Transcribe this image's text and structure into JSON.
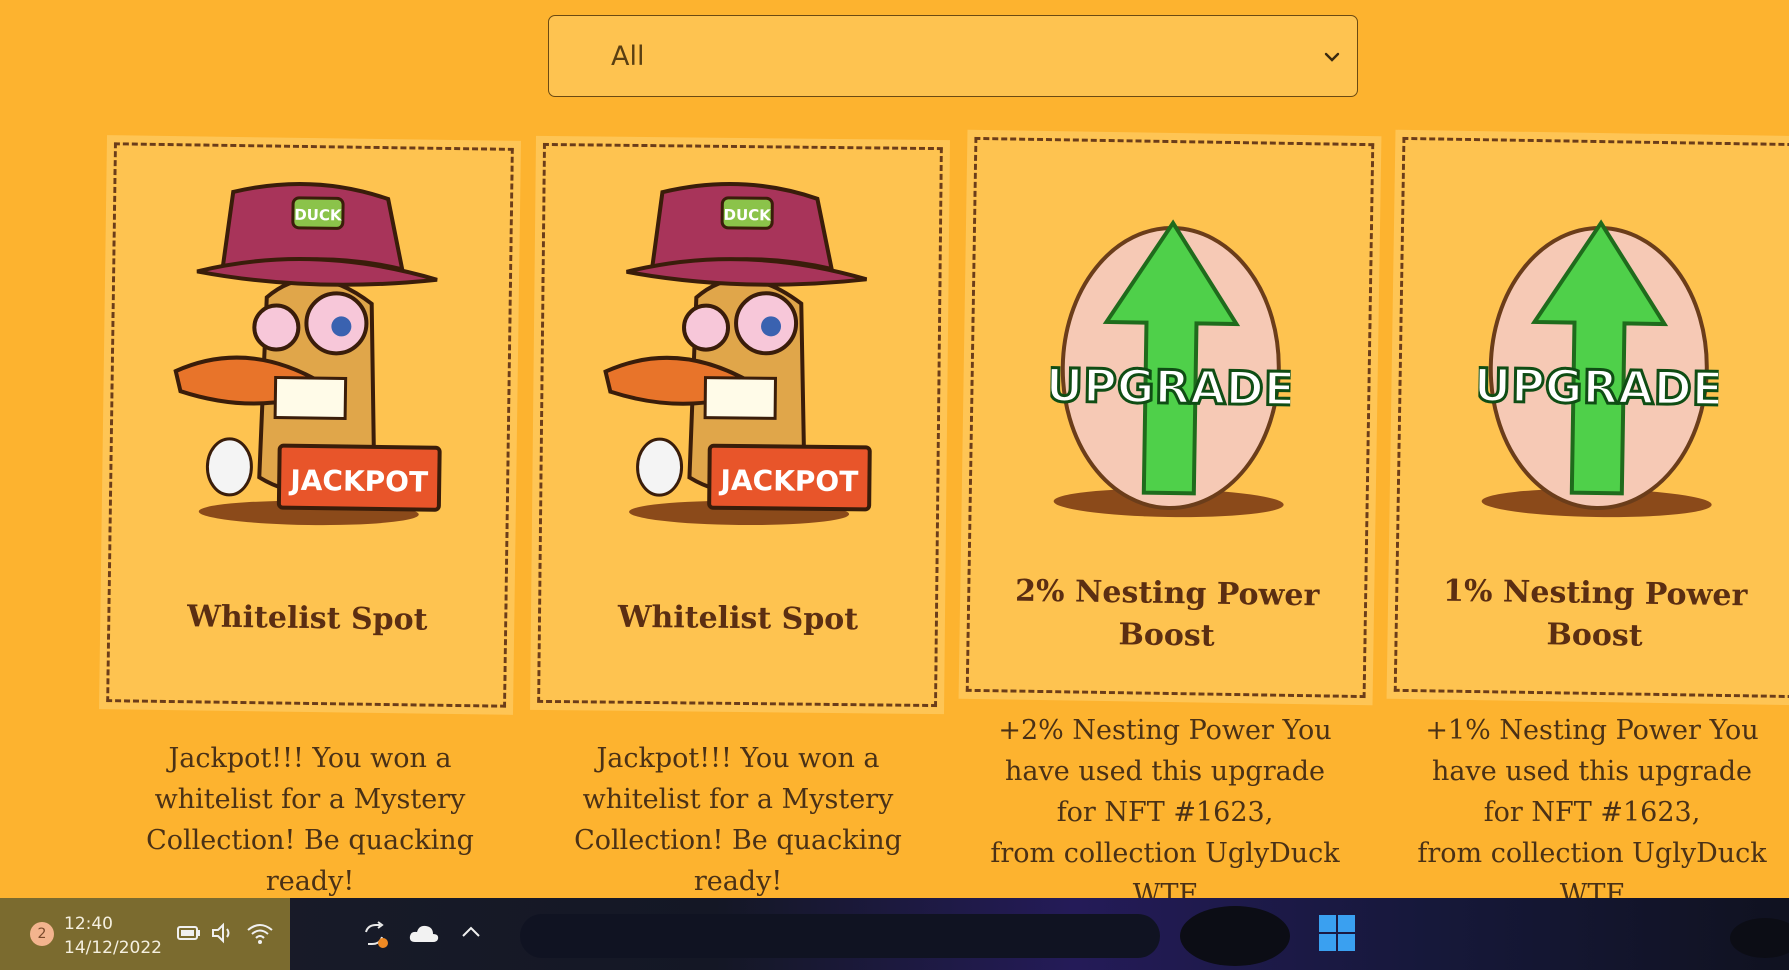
{
  "filter": {
    "selected": "All"
  },
  "cards": [
    {
      "art": "jackpot-duck",
      "art_label": "JACKPOT",
      "hat_label": "DUCK",
      "title": "Whitelist Spot",
      "description_lines": [
        "Jackpot!!! You won a",
        "whitelist for a Mystery",
        "Collection! Be quacking",
        "ready!"
      ]
    },
    {
      "art": "jackpot-duck",
      "art_label": "JACKPOT",
      "hat_label": "DUCK",
      "title": "Whitelist Spot",
      "description_lines": [
        "Jackpot!!! You won a",
        "whitelist for a Mystery",
        "Collection! Be quacking",
        "ready!"
      ]
    },
    {
      "art": "upgrade-egg",
      "art_label": "UPGRADE",
      "title_lines": [
        "2% Nesting Power",
        "Boost"
      ],
      "description_lines": [
        "+2% Nesting Power You",
        "have used this upgrade",
        "for NFT #1623,",
        "from collection UglyDuck",
        "WTF"
      ]
    },
    {
      "art": "upgrade-egg",
      "art_label": "UPGRADE",
      "title_lines": [
        "1% Nesting Power",
        "Boost"
      ],
      "description_lines": [
        "+1% Nesting Power You",
        "have used this upgrade",
        "for NFT #1623,",
        "from collection UglyDuck",
        "WTF"
      ]
    }
  ],
  "taskbar": {
    "notification_count": "2",
    "time": "12:40",
    "date": "14/12/2022",
    "tray_icons": [
      "battery-icon",
      "volume-icon",
      "wifi-icon",
      "sync-icon",
      "onedrive-cloud-icon",
      "chevron-up-icon",
      "windows-start-icon"
    ],
    "accent": "#fdb32f"
  }
}
